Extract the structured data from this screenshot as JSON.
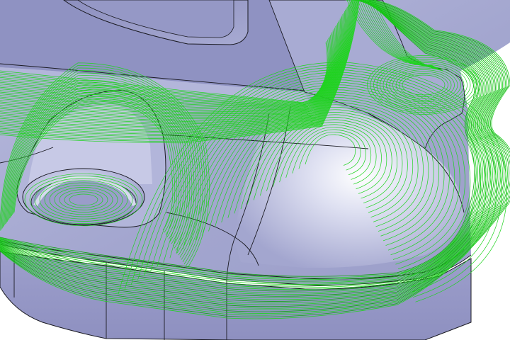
{
  "scene": {
    "kind": "3d-cad-toolpath-view",
    "part": "machined-aluminium-bracket",
    "toolpath_style": "parallel-offset-contours",
    "visible_features": [
      "raised-boss-with-counterbore",
      "pocket-with-rounded-corners",
      "fillet-blend-surface",
      "lower-flange-skirt",
      "offset-toolpath-outside-boundary"
    ],
    "overlays": []
  },
  "colors": {
    "background": "#ffffff",
    "part_face": "#a3a6cf",
    "part_face_light": "#dfe1f2",
    "part_face_shadow": "#8687b8",
    "skirt": "#9596c4",
    "edge": "#1a1a22",
    "toolpath": "#1fd31f",
    "toolpath_dark": "#0ea40e"
  }
}
